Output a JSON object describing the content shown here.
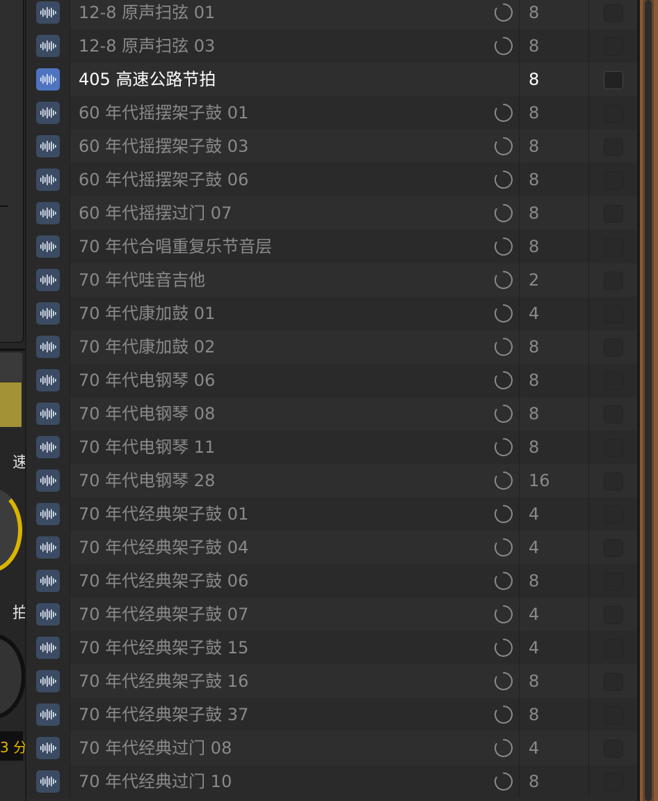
{
  "left_panel": {
    "label_1": "速",
    "label_2": "拍",
    "value_readout": "3 分"
  },
  "columns": [
    "name",
    "loop",
    "beats",
    "favorite"
  ],
  "rows": [
    {
      "name": "12-8 原声扫弦 01",
      "beats": "8",
      "selected": false
    },
    {
      "name": "12-8 原声扫弦 03",
      "beats": "8",
      "selected": false
    },
    {
      "name": "405 高速公路节拍",
      "beats": "8",
      "selected": true
    },
    {
      "name": "60 年代摇摆架子鼓 01",
      "beats": "8",
      "selected": false
    },
    {
      "name": "60 年代摇摆架子鼓 03",
      "beats": "8",
      "selected": false
    },
    {
      "name": "60 年代摇摆架子鼓 06",
      "beats": "8",
      "selected": false
    },
    {
      "name": "60 年代摇摆过门 07",
      "beats": "8",
      "selected": false
    },
    {
      "name": "70 年代合唱重复乐节音层",
      "beats": "8",
      "selected": false
    },
    {
      "name": "70 年代哇音吉他",
      "beats": "2",
      "selected": false
    },
    {
      "name": "70 年代康加鼓 01",
      "beats": "4",
      "selected": false
    },
    {
      "name": "70 年代康加鼓 02",
      "beats": "8",
      "selected": false
    },
    {
      "name": "70 年代电钢琴 06",
      "beats": "8",
      "selected": false
    },
    {
      "name": "70 年代电钢琴 08",
      "beats": "8",
      "selected": false
    },
    {
      "name": "70 年代电钢琴 11",
      "beats": "8",
      "selected": false
    },
    {
      "name": "70 年代电钢琴 28",
      "beats": "16",
      "selected": false
    },
    {
      "name": "70 年代经典架子鼓 01",
      "beats": "4",
      "selected": false
    },
    {
      "name": "70 年代经典架子鼓 04",
      "beats": "4",
      "selected": false
    },
    {
      "name": "70 年代经典架子鼓 06",
      "beats": "8",
      "selected": false
    },
    {
      "name": "70 年代经典架子鼓 07",
      "beats": "4",
      "selected": false
    },
    {
      "name": "70 年代经典架子鼓 15",
      "beats": "4",
      "selected": false
    },
    {
      "name": "70 年代经典架子鼓 16",
      "beats": "8",
      "selected": false
    },
    {
      "name": "70 年代经典架子鼓 37",
      "beats": "8",
      "selected": false
    },
    {
      "name": "70 年代经典过门 08",
      "beats": "4",
      "selected": false
    },
    {
      "name": "70 年代经典过门 10",
      "beats": "8",
      "selected": false
    }
  ],
  "icons": {
    "row_icon": "audio-waveform-icon",
    "loop_icon": "loading-spinner-icon",
    "fav_icon": "checkbox"
  },
  "colors": {
    "selected_icon_bg": "#4f74bf",
    "icon_bg": "#3b4b63",
    "accent_yellow": "#a39236",
    "value_yellow": "#e6b800"
  }
}
